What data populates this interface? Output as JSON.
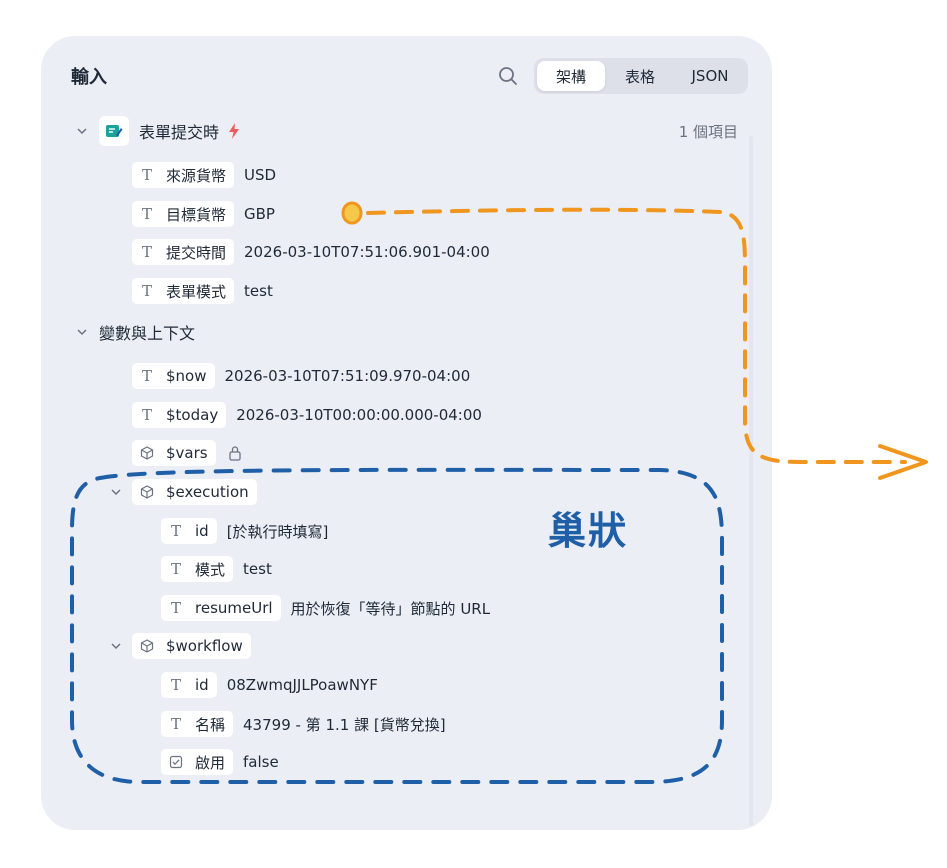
{
  "header": {
    "title": "輸入",
    "tabs": [
      {
        "label": "架構",
        "active": true
      },
      {
        "label": "表格",
        "active": false
      },
      {
        "label": "JSON",
        "active": false
      }
    ]
  },
  "trigger": {
    "label": "表單提交時",
    "count": "1 個項目",
    "fields": [
      {
        "key": "來源貨幣",
        "value": "USD"
      },
      {
        "key": "目標貨幣",
        "value": "GBP"
      },
      {
        "key": "提交時間",
        "value": "2026-03-10T07:51:06.901-04:00"
      },
      {
        "key": "表單模式",
        "value": "test"
      }
    ]
  },
  "context": {
    "label": "變數與上下文",
    "now": {
      "key": "$now",
      "value": "2026-03-10T07:51:09.970-04:00"
    },
    "today": {
      "key": "$today",
      "value": "2026-03-10T00:00:00.000-04:00"
    },
    "vars": {
      "key": "$vars"
    },
    "execution": {
      "key": "$execution",
      "fields": [
        {
          "key": "id",
          "value": "[於執行時填寫]"
        },
        {
          "key": "模式",
          "value": "test"
        },
        {
          "key": "resumeUrl",
          "value": "用於恢復「等待」節點的 URL"
        }
      ]
    },
    "workflow": {
      "key": "$workflow",
      "fields": [
        {
          "key": "id",
          "value": "08ZwmqJJLPoawNYF"
        },
        {
          "key": "名稱",
          "value": "43799 - 第 1.1 課 [貨幣兌換]"
        },
        {
          "key": "啟用",
          "value": "false"
        }
      ]
    }
  },
  "annotation": {
    "nested_label": "巢狀"
  },
  "colors": {
    "panel_bg": "#eceef5",
    "orange_annotation": "#f0961e",
    "blue_annotation": "#1f5fa8",
    "lightning": "#ef5a5a",
    "form_icon": "#1aa39a"
  }
}
